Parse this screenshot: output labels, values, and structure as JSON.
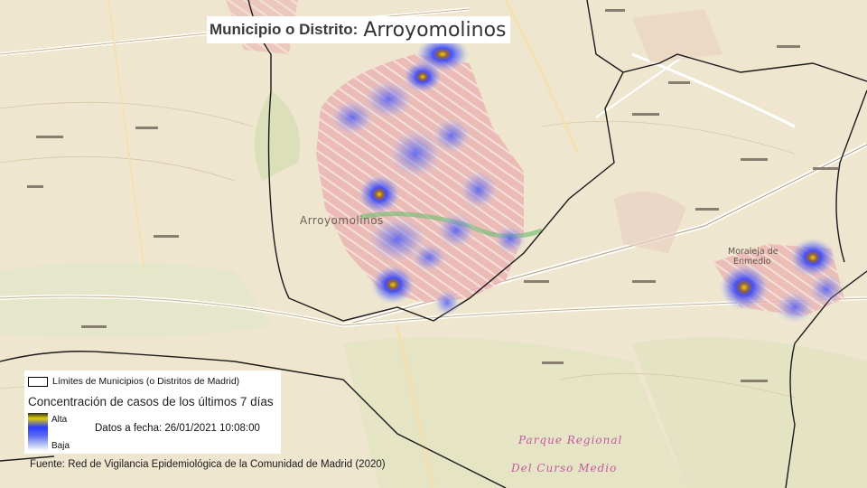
{
  "title": {
    "prefix": "Municipio o Distrito:",
    "name": "Arroyomolinos"
  },
  "legend": {
    "boundary_label": "Límites de Municipios (o Distritos de Madrid)",
    "heat_title": "Concentración de casos de los últimos 7 días",
    "high_label": "Alta",
    "low_label": "Baja",
    "date_text": "Datos a fecha: 26/01/2021 10:08:00"
  },
  "source": "Fuente: Red de Vigilancia Epidemiológica de la Comunidad de Madrid (2020)",
  "map_labels": {
    "main_town": "Arroyomolinos",
    "east_town_line1": "Moraleja de",
    "east_town_line2": "Enmedio",
    "park_line1": "Parque   Regional",
    "park_line2": "Del  Curso  Medio"
  },
  "colors": {
    "heat_high": "#e0d000",
    "heat_mid": "#2a3cff",
    "heat_low": "#b4c0f5",
    "urban": "#e8a8a8",
    "boundary": "#1a1a1a",
    "park_text": "#c45aa0"
  }
}
